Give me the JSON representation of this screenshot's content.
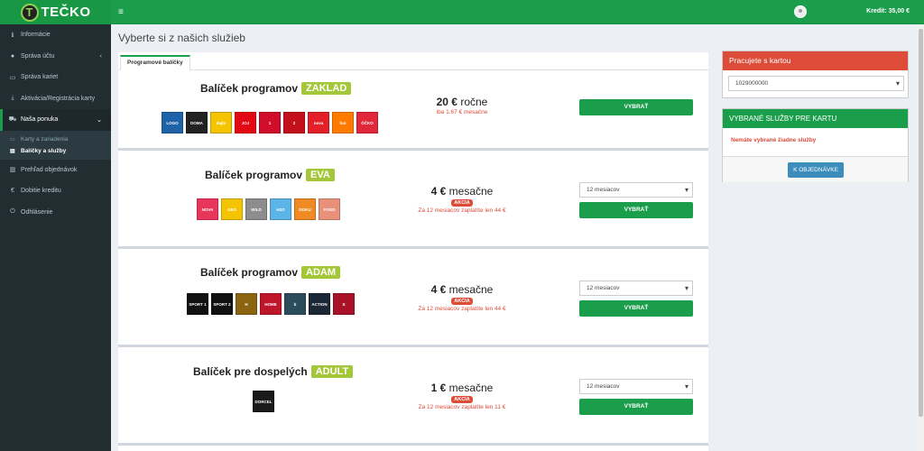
{
  "header": {
    "logo_mark": "T",
    "logo_text": "TEČKO",
    "menu_icon": "≡",
    "credit": "Kredit: 35,00 €"
  },
  "sidebar": {
    "items": [
      {
        "label": "Informácie",
        "icon": "info-icon",
        "glyph": "ℹ"
      },
      {
        "label": "Správa účtu",
        "icon": "user-icon",
        "glyph": "●",
        "chev": "‹"
      },
      {
        "label": "Správa kariet",
        "icon": "card-icon",
        "glyph": "▭"
      },
      {
        "label": "Aktivácia/Registrácia karty",
        "icon": "download-icon",
        "glyph": "⤓"
      },
      {
        "label": "Naša ponuka",
        "icon": "cart-icon",
        "glyph": "⛟",
        "chev": "⌄"
      },
      {
        "label": "Prehľad objednávok",
        "icon": "chart-icon",
        "glyph": "▥"
      },
      {
        "label": "Dobitie kreditu",
        "icon": "euro-icon",
        "glyph": "€"
      },
      {
        "label": "Odhlásenie",
        "icon": "power-icon",
        "glyph": "⏻"
      }
    ],
    "subitems": [
      {
        "label": "Karty a zariadenia",
        "icon": "card-icon",
        "glyph": "▭"
      },
      {
        "label": "Balíčky a služby",
        "icon": "list-icon",
        "glyph": "▤"
      }
    ]
  },
  "page": {
    "title": "Vyberte si z našich služieb",
    "tab": "Programové balíčky"
  },
  "packages": [
    {
      "title": "Balíček programov",
      "badge": "ZAKLAD",
      "price_num": "20 €",
      "price_unit": "ročne",
      "note": "iba 1.67 € mesačne",
      "button": "VYBRAŤ",
      "logos": [
        [
          "LOGO",
          "#1e63a8"
        ],
        [
          "DOMA",
          "#222"
        ],
        [
          "dajto",
          "#f5c400"
        ],
        [
          "JOJ",
          "#e30613"
        ],
        [
          "1",
          "#d00d2a"
        ],
        [
          "2",
          "#c4101d"
        ],
        [
          "nova",
          "#e3202a"
        ],
        [
          "fun",
          "#ff7b00"
        ],
        [
          "ÓČKO",
          "#e1283a"
        ]
      ]
    },
    {
      "title": "Balíček programov",
      "badge": "EVA",
      "price_num": "4 €",
      "price_unit": "mesačne",
      "akcia": "AKCIA",
      "note": "Za 12 mesiacov zaplatíte len 44 €",
      "select": "12 mesiacov",
      "button": "VYBRAŤ",
      "logos": [
        [
          "NOVA",
          "#e8365a"
        ],
        [
          "GEO",
          "#f5c400"
        ],
        [
          "WILD",
          "#8d8d8d"
        ],
        [
          "H2O",
          "#5bb5e8"
        ],
        [
          "DOKU",
          "#f08a24"
        ],
        [
          "FOOD",
          "#e8907a"
        ]
      ]
    },
    {
      "title": "Balíček programov",
      "badge": "ADAM",
      "price_num": "4 €",
      "price_unit": "mesačne",
      "akcia": "AKCIA",
      "note": "Za 12 mesiacov zaplatíte len 44 €",
      "select": "12 mesiacov",
      "button": "VYBRAŤ",
      "logos": [
        [
          "SPORT 1",
          "#111"
        ],
        [
          "SPORT 2",
          "#111"
        ],
        [
          "H",
          "#8a6410"
        ],
        [
          "HOME",
          "#c0162c"
        ],
        [
          "b",
          "#2b4c5a"
        ],
        [
          "ACTION",
          "#1b2735"
        ],
        [
          "S",
          "#a81228"
        ]
      ]
    },
    {
      "title": "Balíček pre dospelých",
      "badge": "ADULT",
      "price_num": "1 €",
      "price_unit": "mesačne",
      "akcia": "AKCIA",
      "note": "Za 12 mesiacov zaplatíte len 11 €",
      "select": "12 mesiacov",
      "button": "VYBRAŤ",
      "logos": [
        [
          "DORCEL",
          "#1a1a1a"
        ]
      ]
    }
  ],
  "card_box": {
    "title": "Pracujete s kartou",
    "value": "1029000000"
  },
  "services_box": {
    "title": "VYBRANÉ SLUŽBY PRE KARTU",
    "message": "Nemáte vybrané žiadne služby",
    "button": "K OBJEDNÁVKE"
  }
}
